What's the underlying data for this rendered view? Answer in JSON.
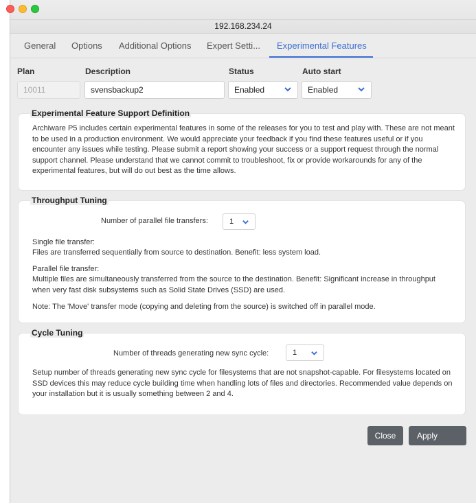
{
  "window": {
    "title": "192.168.234.24"
  },
  "tabs": [
    {
      "label": "General"
    },
    {
      "label": "Options"
    },
    {
      "label": "Additional Options"
    },
    {
      "label": "Expert Setti..."
    },
    {
      "label": "Experimental Features",
      "active": true
    }
  ],
  "plan_row": {
    "headers": {
      "plan": "Plan",
      "description": "Description",
      "status": "Status",
      "auto_start": "Auto start"
    },
    "plan_value": "10011",
    "description_value": "svensbackup2",
    "status_value": "Enabled",
    "auto_start_value": "Enabled"
  },
  "sections": {
    "definition": {
      "title": "Experimental Feature Support Definition",
      "text": "Archiware P5 includes certain experimental features in some of the releases for you to test and play with. These are not meant to be used in a production environment. We would appreciate your feedback if you find these features useful or if you encounter any issues while testing. Please submit a report showing your success or a support request through the normal support channel. Please understand that we cannot commit to troubleshoot, fix or provide workarounds for any of the experimental features, but will do out best as the time allows."
    },
    "throughput": {
      "title": "Throughput Tuning",
      "parallel_label": "Number of parallel file transfers:",
      "parallel_value": "1",
      "single_title": "Single file transfer:",
      "single_text": "Files are transferred sequentially from source to destination. Benefit: less system load.",
      "parallel_title": "Parallel file transfer:",
      "parallel_text": "Multiple files are simultaneously transferred from the source to the destination. Benefit: Significant increase in throughput when very fast disk subsystems such as Solid State Drives (SSD) are used.",
      "note": "Note: The 'Move' transfer mode (copying and deleting from the source) is switched off in parallel mode."
    },
    "cycle": {
      "title": "Cycle Tuning",
      "threads_label": "Number of threads generating new sync cycle:",
      "threads_value": "1",
      "text": "Setup number of threads generating new sync cycle for filesystems that are not snapshot-capable. For filesystems located on SSD devices this may reduce cycle building time when handling lots of files and directories. Recommended value depends on your installation but it is usually something between 2 and 4."
    }
  },
  "buttons": {
    "close": "Close",
    "apply": "Apply"
  },
  "colors": {
    "accent": "#3a6ed4",
    "button": "#5c6168",
    "window_bg": "#ececec"
  }
}
